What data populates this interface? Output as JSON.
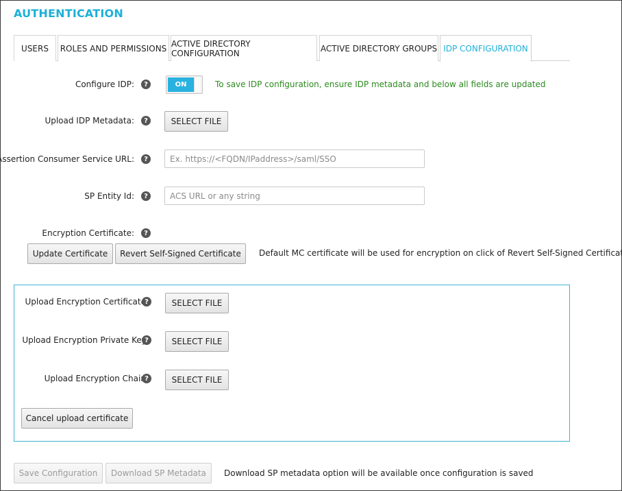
{
  "page": {
    "title": "AUTHENTICATION"
  },
  "tabs": [
    {
      "label": "USERS",
      "active": false
    },
    {
      "label": "ROLES AND PERMISSIONS",
      "active": false
    },
    {
      "label": "ACTIVE DIRECTORY CONFIGURATION",
      "active": false
    },
    {
      "label": "ACTIVE DIRECTORY GROUPS",
      "active": false
    },
    {
      "label": "IDP CONFIGURATION",
      "active": true
    }
  ],
  "form": {
    "configure_idp": {
      "label": "Configure IDP:",
      "toggle_label": "ON",
      "note": "To save IDP configuration, ensure IDP metadata and below all fields are updated"
    },
    "upload_idp_metadata": {
      "label": "Upload IDP Metadata:",
      "button": "SELECT FILE"
    },
    "acs_url": {
      "label": "Assertion Consumer Service URL:",
      "placeholder": "Ex. https://<FQDN/IPaddress>/saml/SSO",
      "value": ""
    },
    "sp_entity_id": {
      "label": "SP Entity Id:",
      "placeholder": "ACS URL or any string",
      "value": ""
    },
    "encryption_certificate": {
      "label": "Encryption Certificate:",
      "update_button": "Update Certificate",
      "revert_button": "Revert Self-Signed Certificate",
      "note": "Default MC certificate will be used for encryption on click of Revert Self-Signed Certificate"
    },
    "help_glyph": "?"
  },
  "upload_panel": {
    "cert": {
      "label": "Upload Encryption Certificate:",
      "button": "SELECT FILE"
    },
    "private_key": {
      "label": "Upload Encryption Private Key:",
      "button": "SELECT FILE"
    },
    "chain": {
      "label": "Upload Encryption Chain:",
      "button": "SELECT FILE"
    },
    "cancel_button": "Cancel upload certificate"
  },
  "footer": {
    "save_button": "Save Configuration",
    "download_button": "Download SP Metadata",
    "note": "Download SP metadata option will be available once configuration is saved"
  },
  "colors": {
    "accent": "#1cb0d8",
    "toggle_on": "#29b2e0",
    "note_green": "#2b8a1e",
    "panel_border": "#3cb3d0"
  }
}
